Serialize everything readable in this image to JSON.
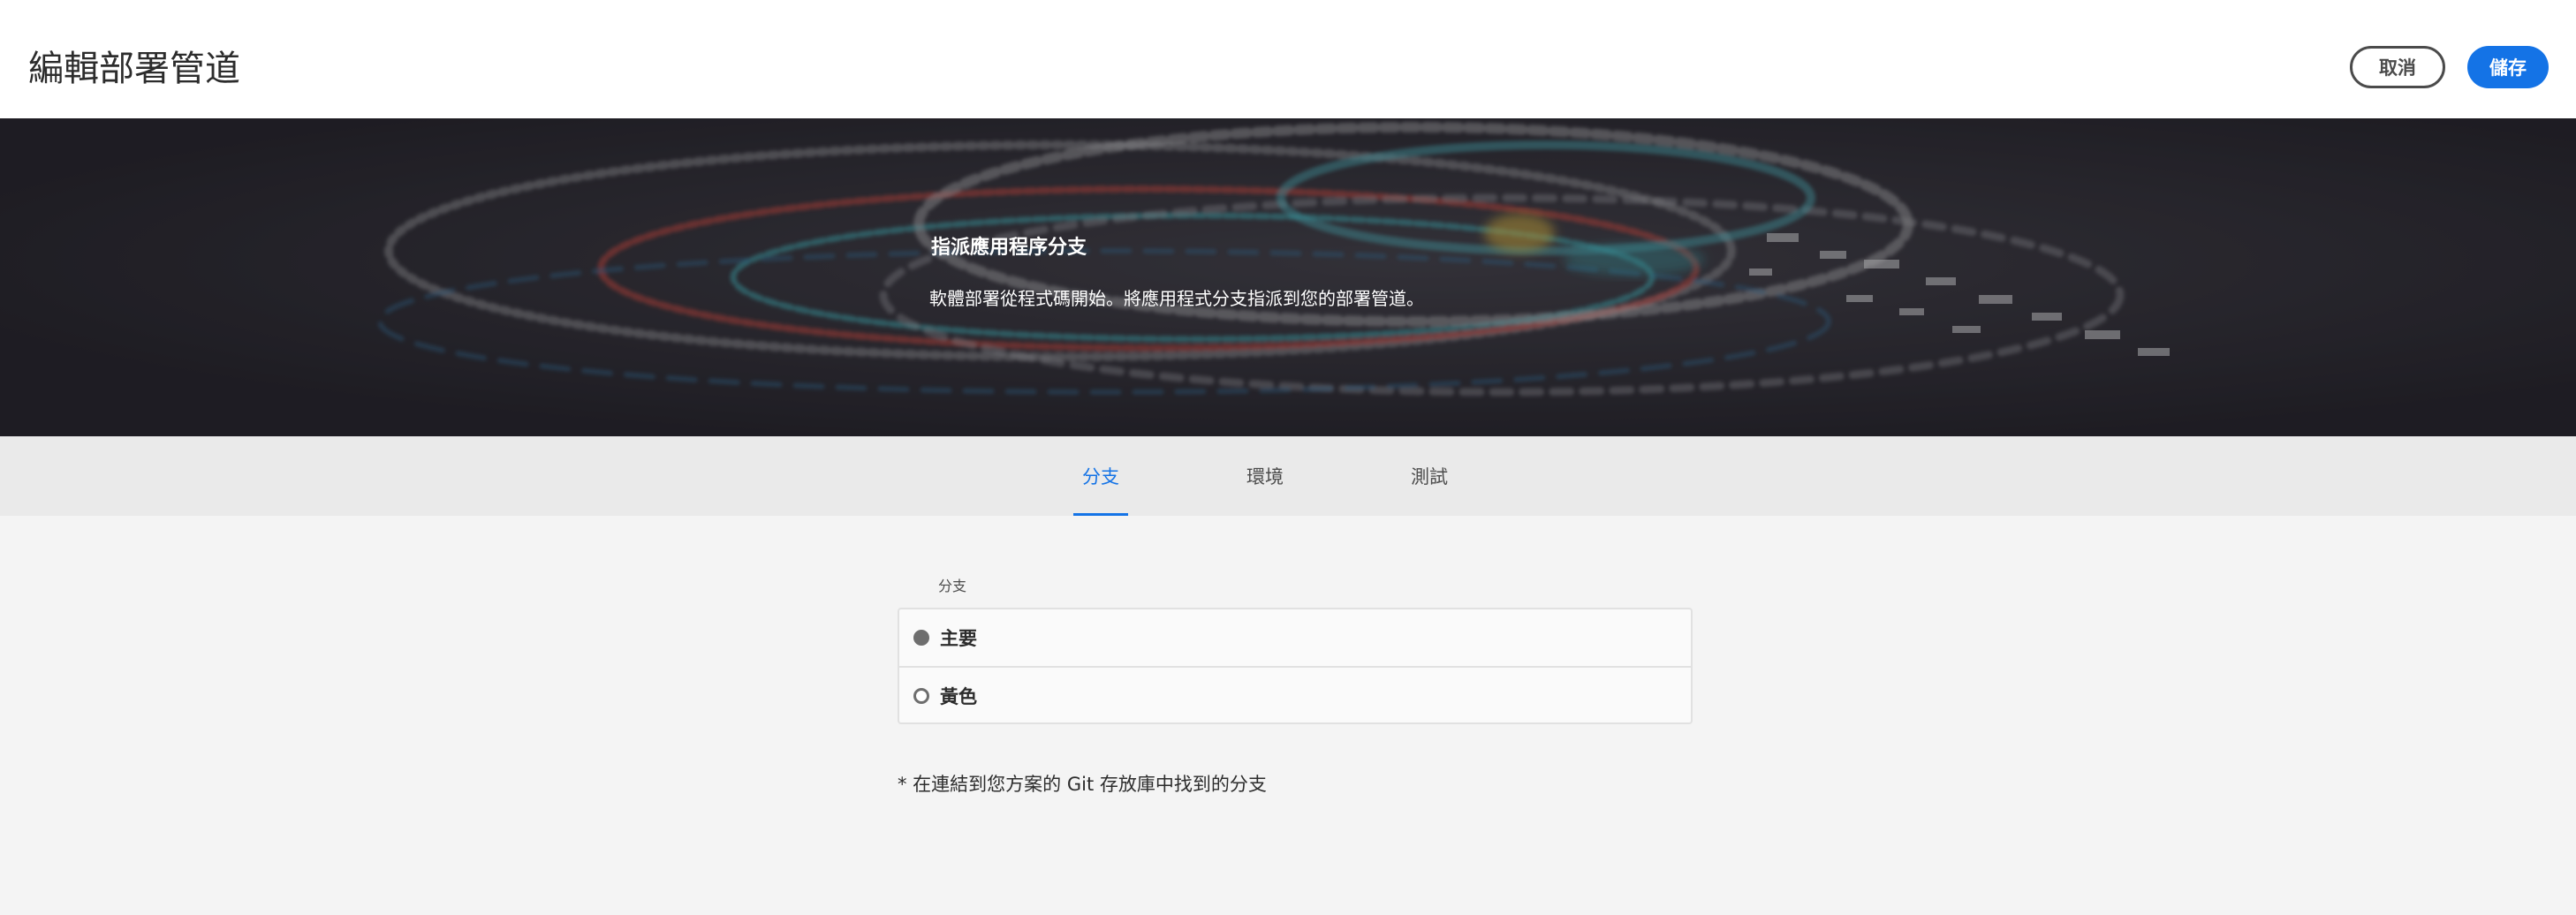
{
  "header": {
    "title": "編輯部署管道",
    "cancel_label": "取消",
    "save_label": "儲存"
  },
  "hero": {
    "title": "指派應用程序分支",
    "description": "軟體部署從程式碼開始。將應用程式分支指派到您的部署管道。"
  },
  "tabs": [
    {
      "label": "分支",
      "active": true
    },
    {
      "label": "環境",
      "active": false
    },
    {
      "label": "測試",
      "active": false
    }
  ],
  "branch": {
    "label": "分支",
    "options": [
      {
        "label": "主要",
        "selected": true
      },
      {
        "label": "黃色",
        "selected": false
      }
    ],
    "footnote": "* 在連結到您方案的 Git 存放庫中找到的分支"
  },
  "colors": {
    "accent": "#1473e6",
    "header_bg": "#ffffff",
    "page_bg": "#f4f4f4",
    "tabbar_bg": "#eaeaea",
    "hero_bg": "#24222a"
  }
}
